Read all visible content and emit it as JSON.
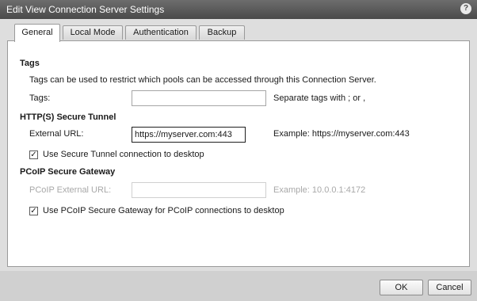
{
  "window": {
    "title": "Edit View Connection Server Settings",
    "help_icon": "question-icon"
  },
  "tabs": [
    {
      "label": "General",
      "active": true
    },
    {
      "label": "Local Mode"
    },
    {
      "label": "Authentication"
    },
    {
      "label": "Backup"
    }
  ],
  "tags_section": {
    "title": "Tags",
    "description": "Tags can be used to restrict which pools can be accessed through this Connection Server.",
    "field_label": "Tags:",
    "value": "",
    "hint": "Separate tags with ; or ,"
  },
  "tunnel_section": {
    "title": "HTTP(S) Secure Tunnel",
    "field_label": "External URL:",
    "value": "https://myserver.com:443",
    "example": "Example: https://myserver.com:443",
    "checkbox_label": "Use Secure Tunnel connection to desktop",
    "checked": true
  },
  "pcoip_section": {
    "title": "PCoIP Secure Gateway",
    "field_label": "PCoIP External URL:",
    "value": "",
    "example": "Example: 10.0.0.1:4172",
    "checkbox_label": "Use PCoIP Secure Gateway for PCoIP connections to desktop",
    "checked": true
  },
  "footer": {
    "ok_label": "OK",
    "cancel_label": "Cancel"
  }
}
